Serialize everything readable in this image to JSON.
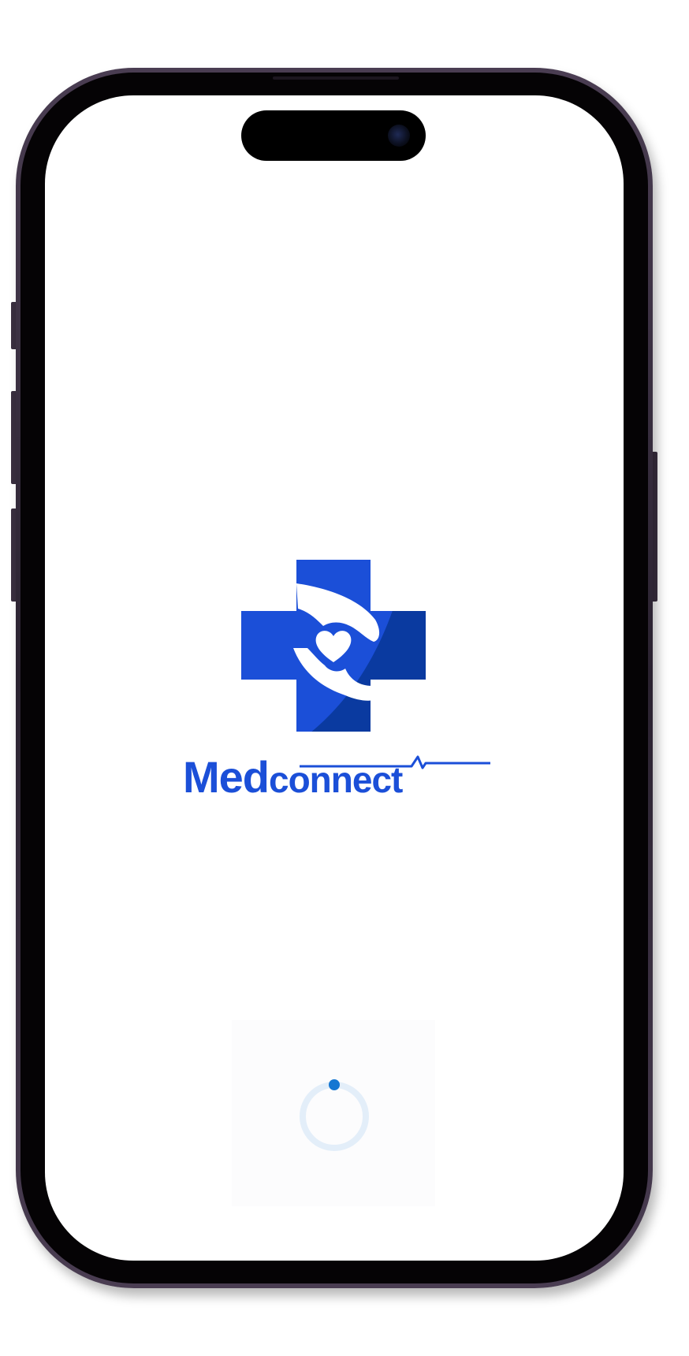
{
  "app": {
    "name_part_1": "Med",
    "name_part_2": "connect"
  },
  "logo": {
    "icon_name": "medical-cross-hands-heart-icon",
    "primary_color": "#1b4fd8",
    "secondary_color": "#0a3aa0"
  },
  "loader": {
    "icon_name": "loading-spinner-icon",
    "track_color": "#e3eef9",
    "indicator_color": "#1677d2"
  }
}
